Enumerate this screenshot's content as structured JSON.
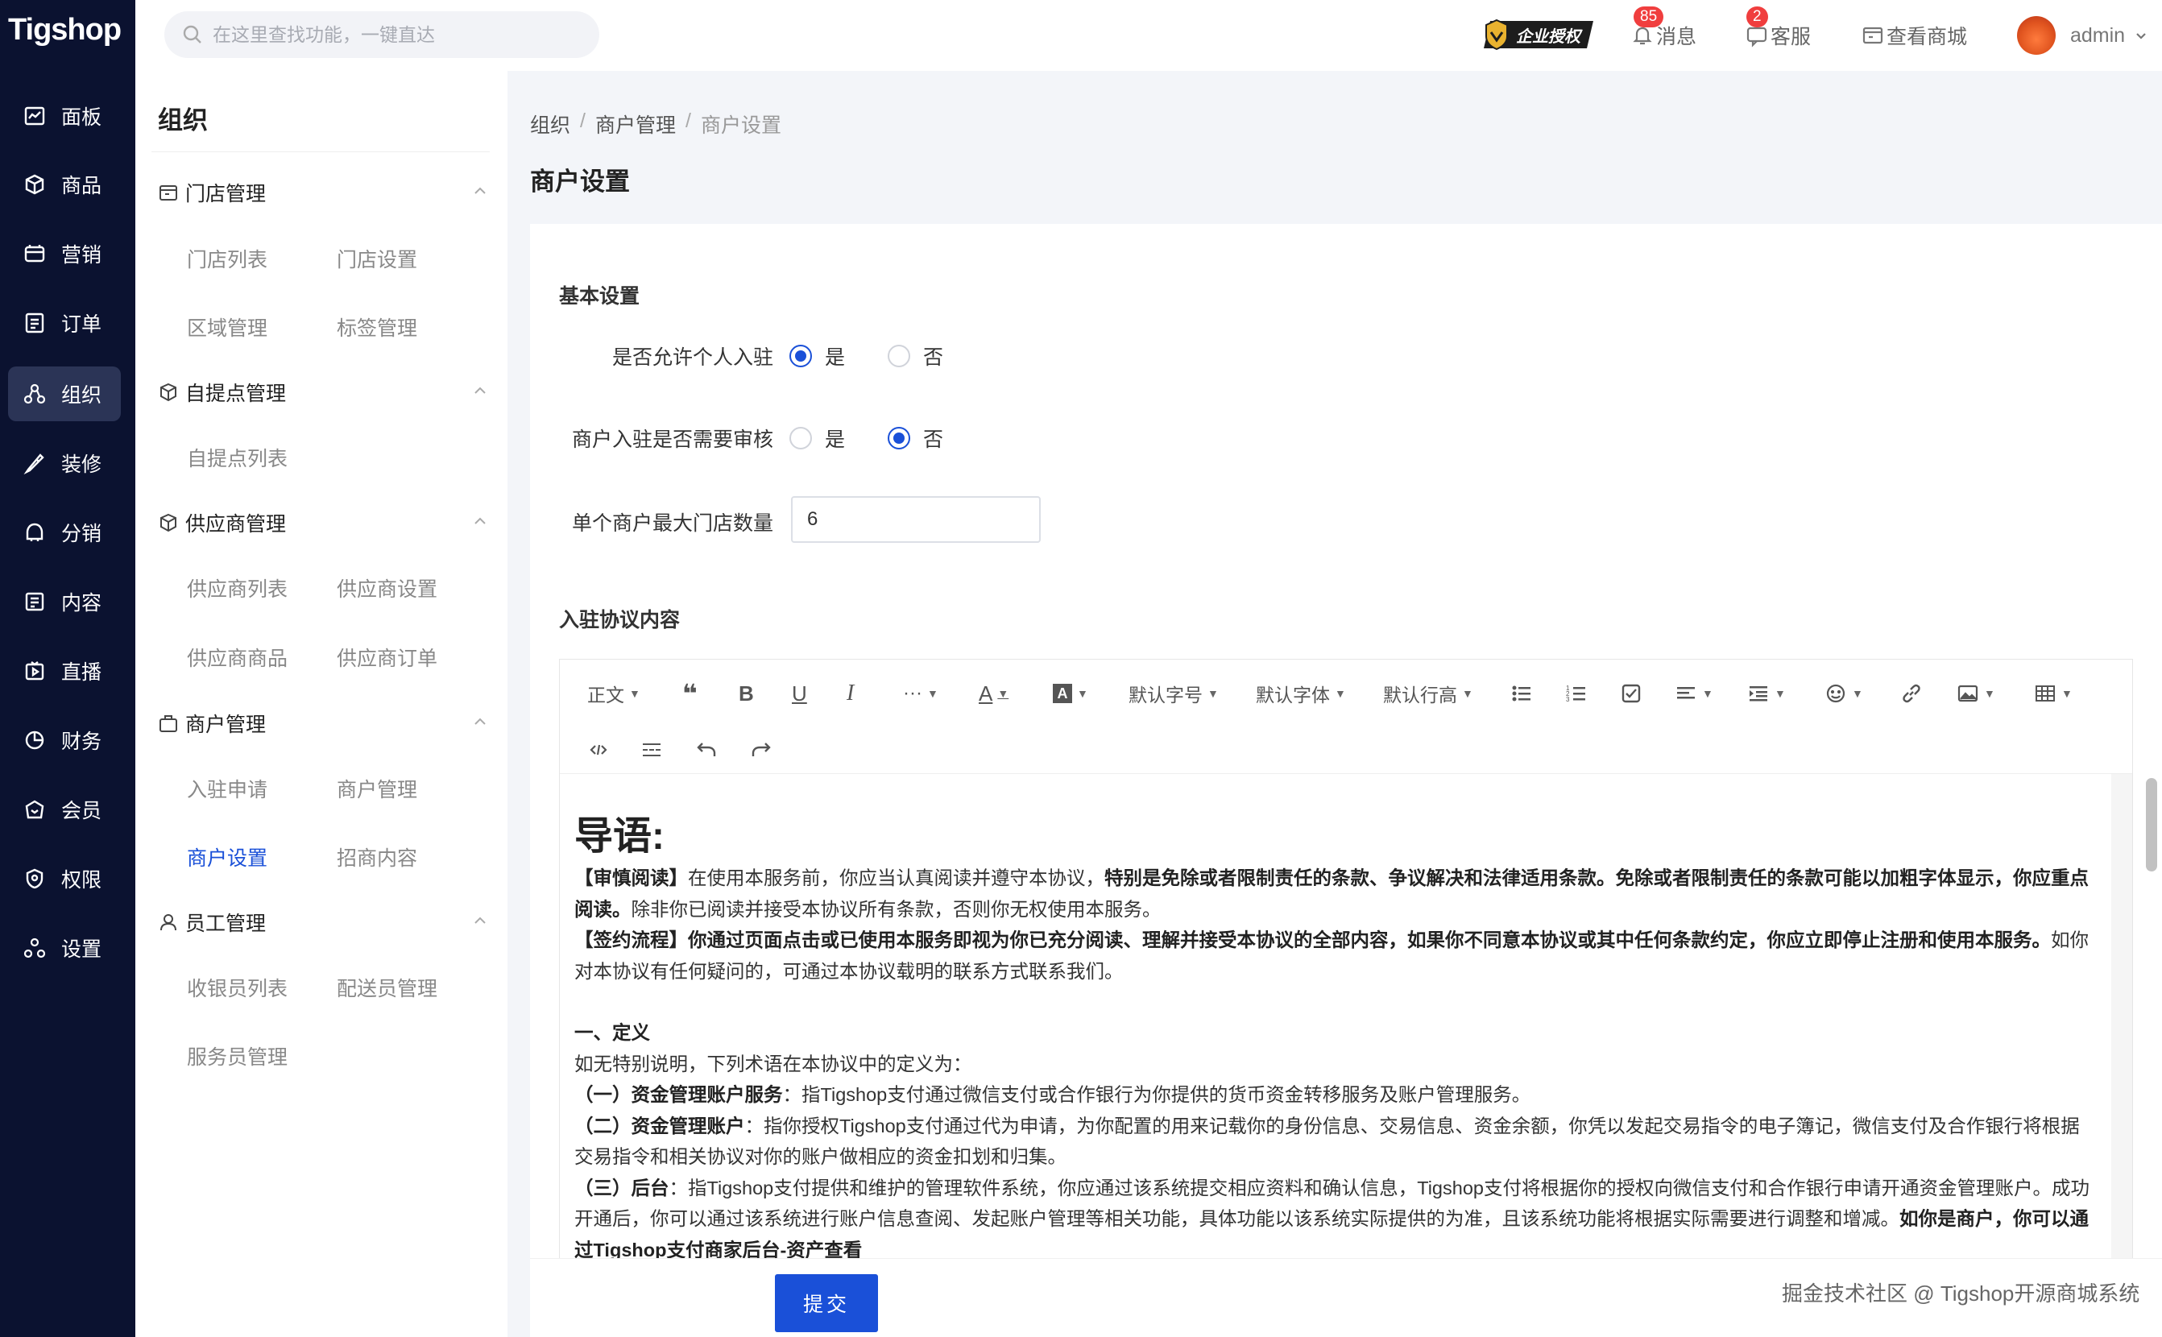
{
  "app": {
    "logo_text": "Tigshop"
  },
  "rail": {
    "items": [
      {
        "label": "面板",
        "icon": "dashboard-icon"
      },
      {
        "label": "商品",
        "icon": "cube-icon"
      },
      {
        "label": "营销",
        "icon": "marketing-icon"
      },
      {
        "label": "订单",
        "icon": "order-icon"
      },
      {
        "label": "组织",
        "icon": "organization-icon",
        "active": true
      },
      {
        "label": "装修",
        "icon": "brush-icon"
      },
      {
        "label": "分销",
        "icon": "distribution-icon"
      },
      {
        "label": "内容",
        "icon": "content-icon"
      },
      {
        "label": "直播",
        "icon": "live-icon"
      },
      {
        "label": "财务",
        "icon": "finance-icon"
      },
      {
        "label": "会员",
        "icon": "member-icon"
      },
      {
        "label": "权限",
        "icon": "shield-icon"
      },
      {
        "label": "设置",
        "icon": "settings-icon"
      }
    ]
  },
  "header": {
    "search_placeholder": "在这里查找功能，一键直达",
    "license_label": "企业授权",
    "messages_label": "消息",
    "messages_count": "85",
    "service_label": "客服",
    "service_count": "2",
    "view_store_label": "查看商城",
    "user_name": "admin"
  },
  "subnav": {
    "title": "组织",
    "groups": [
      {
        "label": "门店管理",
        "items": [
          "门店列表",
          "门店设置",
          "区域管理",
          "标签管理"
        ]
      },
      {
        "label": "自提点管理",
        "items": [
          "自提点列表"
        ]
      },
      {
        "label": "供应商管理",
        "items": [
          "供应商列表",
          "供应商设置",
          "供应商商品",
          "供应商订单"
        ]
      },
      {
        "label": "商户管理",
        "items": [
          "入驻申请",
          "商户管理",
          "商户设置",
          "招商内容"
        ],
        "active_item": "商户设置"
      },
      {
        "label": "员工管理",
        "items": [
          "收银员列表",
          "配送员管理",
          "服务员管理"
        ]
      }
    ]
  },
  "breadcrumb": {
    "items": [
      "组织",
      "商户管理",
      "商户设置"
    ],
    "separator": "/"
  },
  "page": {
    "title": "商户设置"
  },
  "form": {
    "basic_section": "基本设置",
    "allow_personal_label": "是否允许个人入驻",
    "allow_personal_value": "是",
    "need_review_label": "商户入驻是否需要审核",
    "need_review_value": "否",
    "yes_label": "是",
    "no_label": "否",
    "max_store_label": "单个商户最大门店数量",
    "max_store_value": "6",
    "agreement_section": "入驻协议内容",
    "submit_label": "提交"
  },
  "editor": {
    "toolbar": {
      "paragraph": "正文",
      "font_size": "默认字号",
      "font_family": "默认字体",
      "line_height": "默认行高"
    },
    "content": {
      "heading": "导语:",
      "p1_a": "【审慎阅读】",
      "p1_b": "在使用本服务前，你应当认真阅读并遵守本协议，",
      "p1_c": "特别是免除或者限制责任的条款、争议解决和法律适用条款。免除或者限制责任的条款可能以加粗字体显示，你应重点阅读。",
      "p1_d": "除非你已阅读并接受本协议所有条款，否则你无权使用本服务。",
      "p2_a": "【签约流程】你通过页面点击或已使用本服务即视为你已充分阅读、理解并接受本协议的全部内容，如果你不同意本协议或其中任何条款约定，你应立即停止注册和使用本服务。",
      "p2_b": "如你对本协议有任何疑问的，可通过本协议载明的联系方式联系我们。",
      "s1_title": "一、定义",
      "s1_intro": "如无特别说明，下列术语在本协议中的定义为：",
      "d1_a": "（一）资金管理账户服务",
      "d1_b": "：指Tigshop支付通过微信支付或合作银行为你提供的货币资金转移服务及账户管理服务。",
      "d2_a": "（二）资金管理账户",
      "d2_b": "：指你授权Tigshop支付通过代为申请，为你配置的用来记载你的身份信息、交易信息、资金余额，你凭以发起交易指令的电子簿记，微信支付及合作银行将根据交易指令和相关协议对你的账户做相应的资金扣划和归集。",
      "d3_a": "（三）后台",
      "d3_b": "：指Tigshop支付提供和维护的管理软件系统，你应通过该系统提交相应资料和确认信息，Tigshop支付将根据你的授权向微信支付和合作银行申请开通资金管理账户。成功开通后，你可以通过该系统进行账户信息查阅、发起账户管理等相关功能，具体功能以该系统实际提供的为准，且该系统功能将根据实际需要进行调整和增减。",
      "d3_c": "如你是商户，你可以通过Tigshop支付商家后台-资产查看"
    }
  },
  "watermark": "掘金技术社区 @ Tigshop开源商城系统"
}
